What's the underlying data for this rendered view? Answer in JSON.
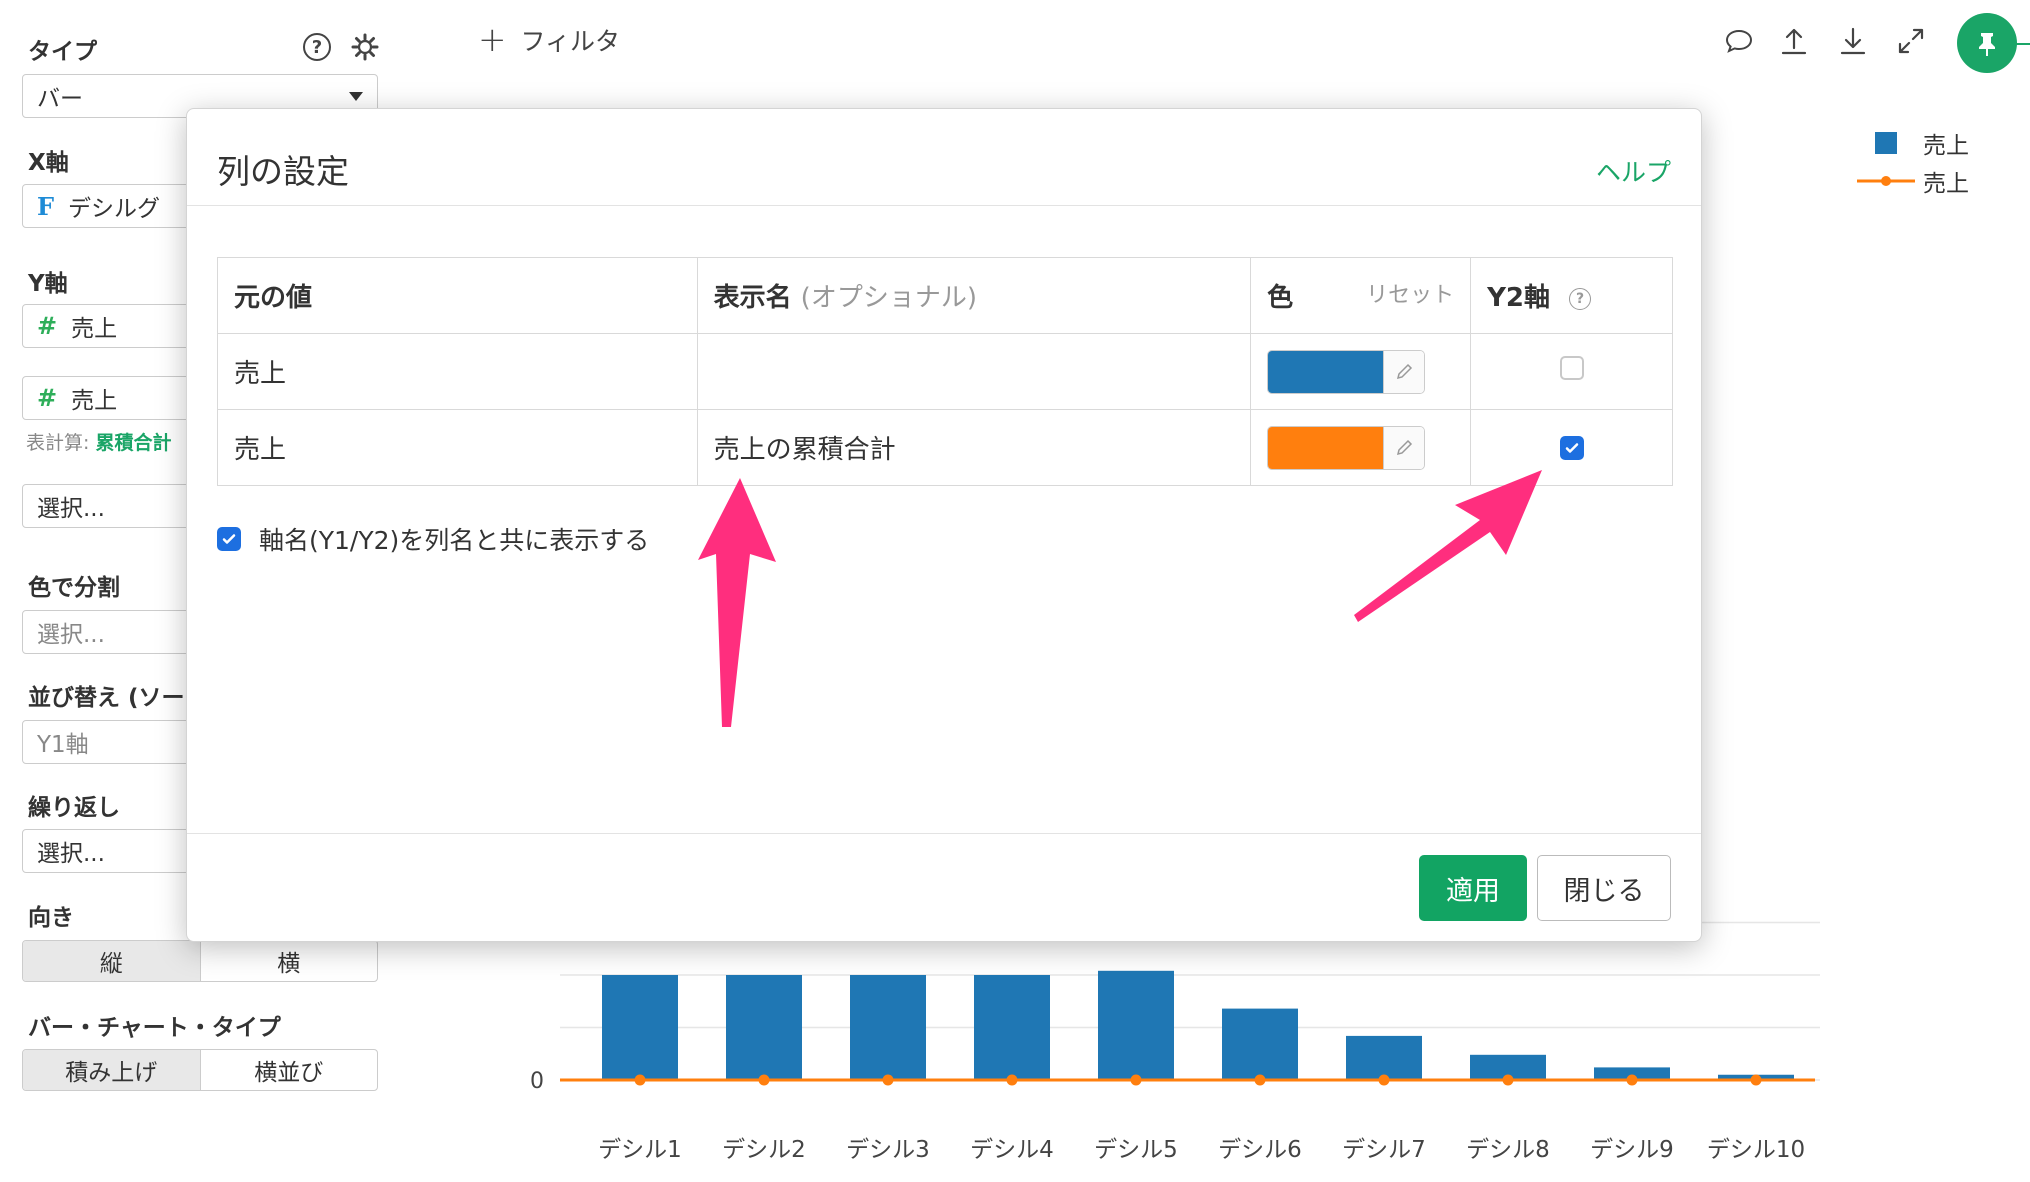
{
  "sidebar": {
    "type_label": "タイプ",
    "type_value": "バー",
    "x_axis_label": "X軸",
    "x_axis_field": "デシルグ",
    "y_axis_label": "Y軸",
    "y_axis_field1": "売上",
    "y_axis_field2": "売上",
    "table_calc_prefix": "表計算:",
    "table_calc_value": "累積合計",
    "select_placeholder": "選択...",
    "color_split_label": "色で分割",
    "sort_label": "並び替え (ソー",
    "sort_value": "Y1軸",
    "repeat_label": "繰り返し",
    "orientation_label": "向き",
    "orientation_options": [
      "縦",
      "横"
    ],
    "bar_type_label": "バー・チャート・タイプ",
    "bar_type_options": [
      "積み上げ",
      "横並び"
    ]
  },
  "toolbar": {
    "filter_label": "フィルタ",
    "icons": [
      "comment-icon",
      "upload-icon",
      "download-icon",
      "expand-icon",
      "pin-icon"
    ]
  },
  "legend": {
    "items": [
      {
        "label": "売上",
        "color": "#1f77b4",
        "kind": "bar"
      },
      {
        "label": "売上",
        "color": "#ff7f0e",
        "kind": "line"
      }
    ]
  },
  "chart_data": {
    "type": "bar",
    "categories": [
      "デシル1",
      "デシル2",
      "デシル3",
      "デシル4",
      "デシル5",
      "デシル6",
      "デシル7",
      "デシル8",
      "デシル9",
      "デシル10"
    ],
    "series": [
      {
        "name": "売上",
        "type": "bar",
        "color": "#1f77b4",
        "values": [
          100,
          100,
          100,
          100,
          104,
          68,
          42,
          24,
          12,
          5
        ]
      },
      {
        "name": "売上",
        "type": "line",
        "color": "#ff7f0e",
        "values": [
          0,
          0,
          0,
          0,
          0,
          0,
          0,
          0,
          0,
          0
        ]
      }
    ],
    "y_tick_labels": [
      "0"
    ],
    "ylim": [
      0,
      150
    ],
    "grid": true
  },
  "modal": {
    "title": "列の設定",
    "help_label": "ヘルプ",
    "headers": {
      "original": "元の値",
      "display_name": "表示名",
      "display_name_hint": "(オプショナル)",
      "color": "色",
      "reset": "リセット",
      "y2": "Y2軸"
    },
    "rows": [
      {
        "original": "売上",
        "display_name": "",
        "color": "#1f77b4",
        "y2": false
      },
      {
        "original": "売上",
        "display_name": "売上の累積合計",
        "color": "#ff7f0e",
        "y2": true
      }
    ],
    "show_axis_name_label": "軸名(Y1/Y2)を列名と共に表示する",
    "show_axis_name_checked": true,
    "apply_label": "適用",
    "close_label": "閉じる"
  },
  "annotation_color": "#ff2e7e"
}
